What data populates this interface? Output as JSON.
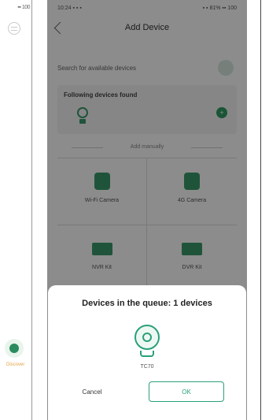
{
  "left_screen": {
    "status_text": "▪▪ 100",
    "tab_label": "Discover"
  },
  "status_bar": {
    "left": "10:24 ▪ ▪ ▪",
    "right": "▪ ▪ 81% ▪▪ 100"
  },
  "header": {
    "title": "Add Device"
  },
  "scan": {
    "label": "Search for available devices"
  },
  "found": {
    "title": "Following devices found"
  },
  "manual": {
    "label": "Add manually"
  },
  "device_types": [
    {
      "label": "Wi-Fi Camera"
    },
    {
      "label": "4G Camera"
    },
    {
      "label": "NVR Kit"
    },
    {
      "label": "DVR Kit"
    }
  ],
  "dialog": {
    "title": "Devices in the queue: 1 devices",
    "device_label": "TC70",
    "cancel_label": "Cancel",
    "ok_label": "OK"
  },
  "colors": {
    "accent": "#2aa07a",
    "overlay": "rgba(0,0,0,0.45)"
  }
}
